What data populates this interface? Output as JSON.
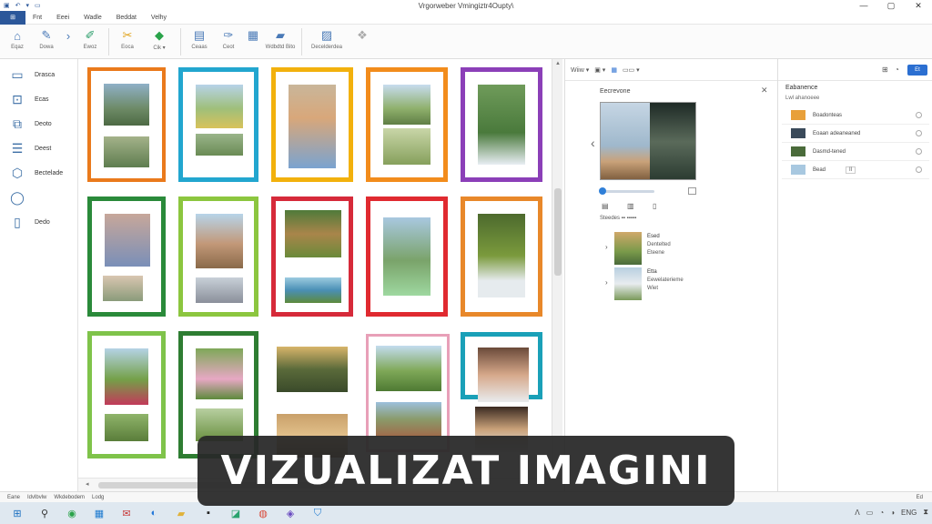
{
  "window": {
    "title": "Vrgorweber Vmingiztr4Oupty\\",
    "quick_access": [
      "▣",
      "↶",
      "▾",
      "▭"
    ],
    "controls": [
      "—",
      "▢",
      "✕"
    ]
  },
  "menu": {
    "file_tab": "⊞",
    "items": [
      "Fnt",
      "Eeei",
      "Wadle",
      "Beddat",
      "Velhy"
    ]
  },
  "ribbon": {
    "buttons": [
      {
        "icon": "home-icon",
        "glyph": "⌂",
        "label": "Eqaz"
      },
      {
        "icon": "edit-icon",
        "glyph": "✎",
        "label": "Dowa"
      },
      {
        "icon": "forward-icon",
        "glyph": "›",
        "label": ""
      },
      {
        "icon": "pen-icon",
        "glyph": "✐",
        "label": "Ewoz"
      },
      {
        "icon": "cut-icon",
        "glyph": "✂",
        "label": "Eoca"
      },
      {
        "icon": "color-icon",
        "glyph": "◆",
        "label": "Cik ▾"
      },
      {
        "icon": "page-icon",
        "glyph": "▤",
        "label": "Ceaas"
      },
      {
        "icon": "brush-icon",
        "glyph": "✑",
        "label": "Ceot"
      },
      {
        "icon": "grid-icon",
        "glyph": "▦",
        "label": ""
      },
      {
        "icon": "folder-icon",
        "glyph": "▰",
        "label": "Wdbdtd Bito"
      },
      {
        "icon": "document-icon",
        "glyph": "▨",
        "label": "Decelderdea"
      },
      {
        "icon": "group-icon",
        "glyph": "❖",
        "label": ""
      }
    ]
  },
  "sidebar": {
    "items": [
      {
        "icon": "gallery-icon",
        "glyph": "▭",
        "label": "Drasca"
      },
      {
        "icon": "image-icon",
        "glyph": "⊡",
        "label": "Ecas"
      },
      {
        "icon": "edit-box-icon",
        "glyph": "⧉",
        "label": "Deoto"
      },
      {
        "icon": "list-icon",
        "glyph": "☰",
        "label": "Deest"
      },
      {
        "icon": "box-icon",
        "glyph": "⬡",
        "label": "Bectelade"
      },
      {
        "icon": "shape-icon",
        "glyph": "◯",
        "label": ""
      },
      {
        "icon": "book-icon",
        "glyph": "▯",
        "label": "Dedo"
      }
    ]
  },
  "preview": {
    "toolbar": [
      "Wiiw ▾",
      "▣ ▾",
      "▦",
      "▭▭ ▾"
    ],
    "heading": "Eecrevone",
    "close": "✕",
    "nav_prev": "‹",
    "subtitle": "Steedes ▪▪  ▪▪▪▪▪",
    "mini_buttons": [
      "▤",
      "▥",
      "▯"
    ],
    "items": [
      {
        "l1": "Esed",
        "l2": "Dentelted",
        "l3": "Eteene"
      },
      {
        "l1": "Etta",
        "l2": "Eewelaterieme",
        "l3": "Wiet"
      }
    ]
  },
  "properties": {
    "header_buttons": [
      "⊞",
      "◔"
    ],
    "go_label": "Et",
    "title": "Eabanence",
    "subtitle": "Lwl ahanoeee",
    "rows": [
      {
        "label": "Boadonteas",
        "color": "#e8a03a"
      },
      {
        "label": "Eoaan adeaneaned",
        "color": "#3a4a5a"
      },
      {
        "label": "Dasmd-tened",
        "color": "#4a6b3a"
      },
      {
        "label": "Bead",
        "color": "#a8c8e0",
        "value": "Il"
      }
    ]
  },
  "statusbar": {
    "items": [
      "Eane",
      "Idvlbvlw",
      "Wkdebodem",
      "Lodg"
    ],
    "right": "Ed"
  },
  "taskbar": {
    "icons": [
      {
        "name": "windows-start-icon",
        "glyph": "⊞",
        "color": "#1a6fc0"
      },
      {
        "name": "search-icon",
        "glyph": "⚲",
        "color": "#333"
      },
      {
        "name": "browser-icon",
        "glyph": "◉",
        "color": "#2aa34a"
      },
      {
        "name": "calculator-icon",
        "glyph": "▦",
        "color": "#1f7bd0"
      },
      {
        "name": "mail-icon",
        "glyph": "✉",
        "color": "#c83a3a"
      },
      {
        "name": "edge-icon",
        "glyph": "◐",
        "color": "#2277d9"
      },
      {
        "name": "explorer-icon",
        "glyph": "▰",
        "color": "#e0b23a"
      },
      {
        "name": "terminal-icon",
        "glyph": "▪",
        "color": "#222"
      },
      {
        "name": "photos-icon",
        "glyph": "◪",
        "color": "#2aa36e"
      },
      {
        "name": "chrome-icon",
        "glyph": "◍",
        "color": "#d94a3a"
      },
      {
        "name": "store-icon",
        "glyph": "◈",
        "color": "#6a4ac0"
      },
      {
        "name": "shield-icon",
        "glyph": "⛉",
        "color": "#1f7bd0"
      }
    ],
    "tray": [
      "ᐱ",
      "▭",
      "◔",
      "◑",
      "ENG",
      "⧗"
    ]
  },
  "caption": "VIZUALIZAT IMAGINI",
  "colors": {
    "accent": "#2b579a",
    "frames": [
      "#ea7a1c",
      "#22a6cf",
      "#f2b10d",
      "#f28c1c",
      "#8b3fb8",
      "#2a8a3a",
      "#8cc63f",
      "#d62a3a",
      "#e02a30",
      "#e8882a",
      "#7fc34a",
      "#2e7d32",
      "#e8a0b8",
      "#1aa0b8"
    ]
  }
}
